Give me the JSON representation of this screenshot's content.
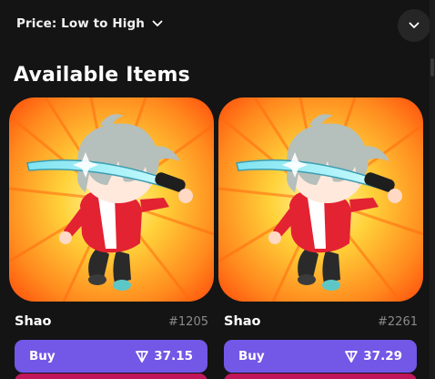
{
  "sort": {
    "label": "Price: Low to High",
    "icon": "chevron-down-icon"
  },
  "collapse_button": {
    "icon": "chevron-down-icon"
  },
  "section": {
    "title": "Available Items"
  },
  "items": [
    {
      "name": "Shao",
      "id": "#1205",
      "buy_label": "Buy",
      "price": "37.15",
      "currency_icon": "ton-diamond-icon",
      "image": "chibi-swordsman-artwork"
    },
    {
      "name": "Shao",
      "id": "#2261",
      "buy_label": "Buy",
      "price": "37.29",
      "currency_icon": "ton-diamond-icon",
      "image": "chibi-swordsman-artwork"
    }
  ],
  "colors": {
    "background": "#141414",
    "buy_button": "#7357e6",
    "id_text": "#8a8a8a",
    "art_burst_light": "#ffe14a",
    "art_burst_dark": "#ff5a10"
  }
}
